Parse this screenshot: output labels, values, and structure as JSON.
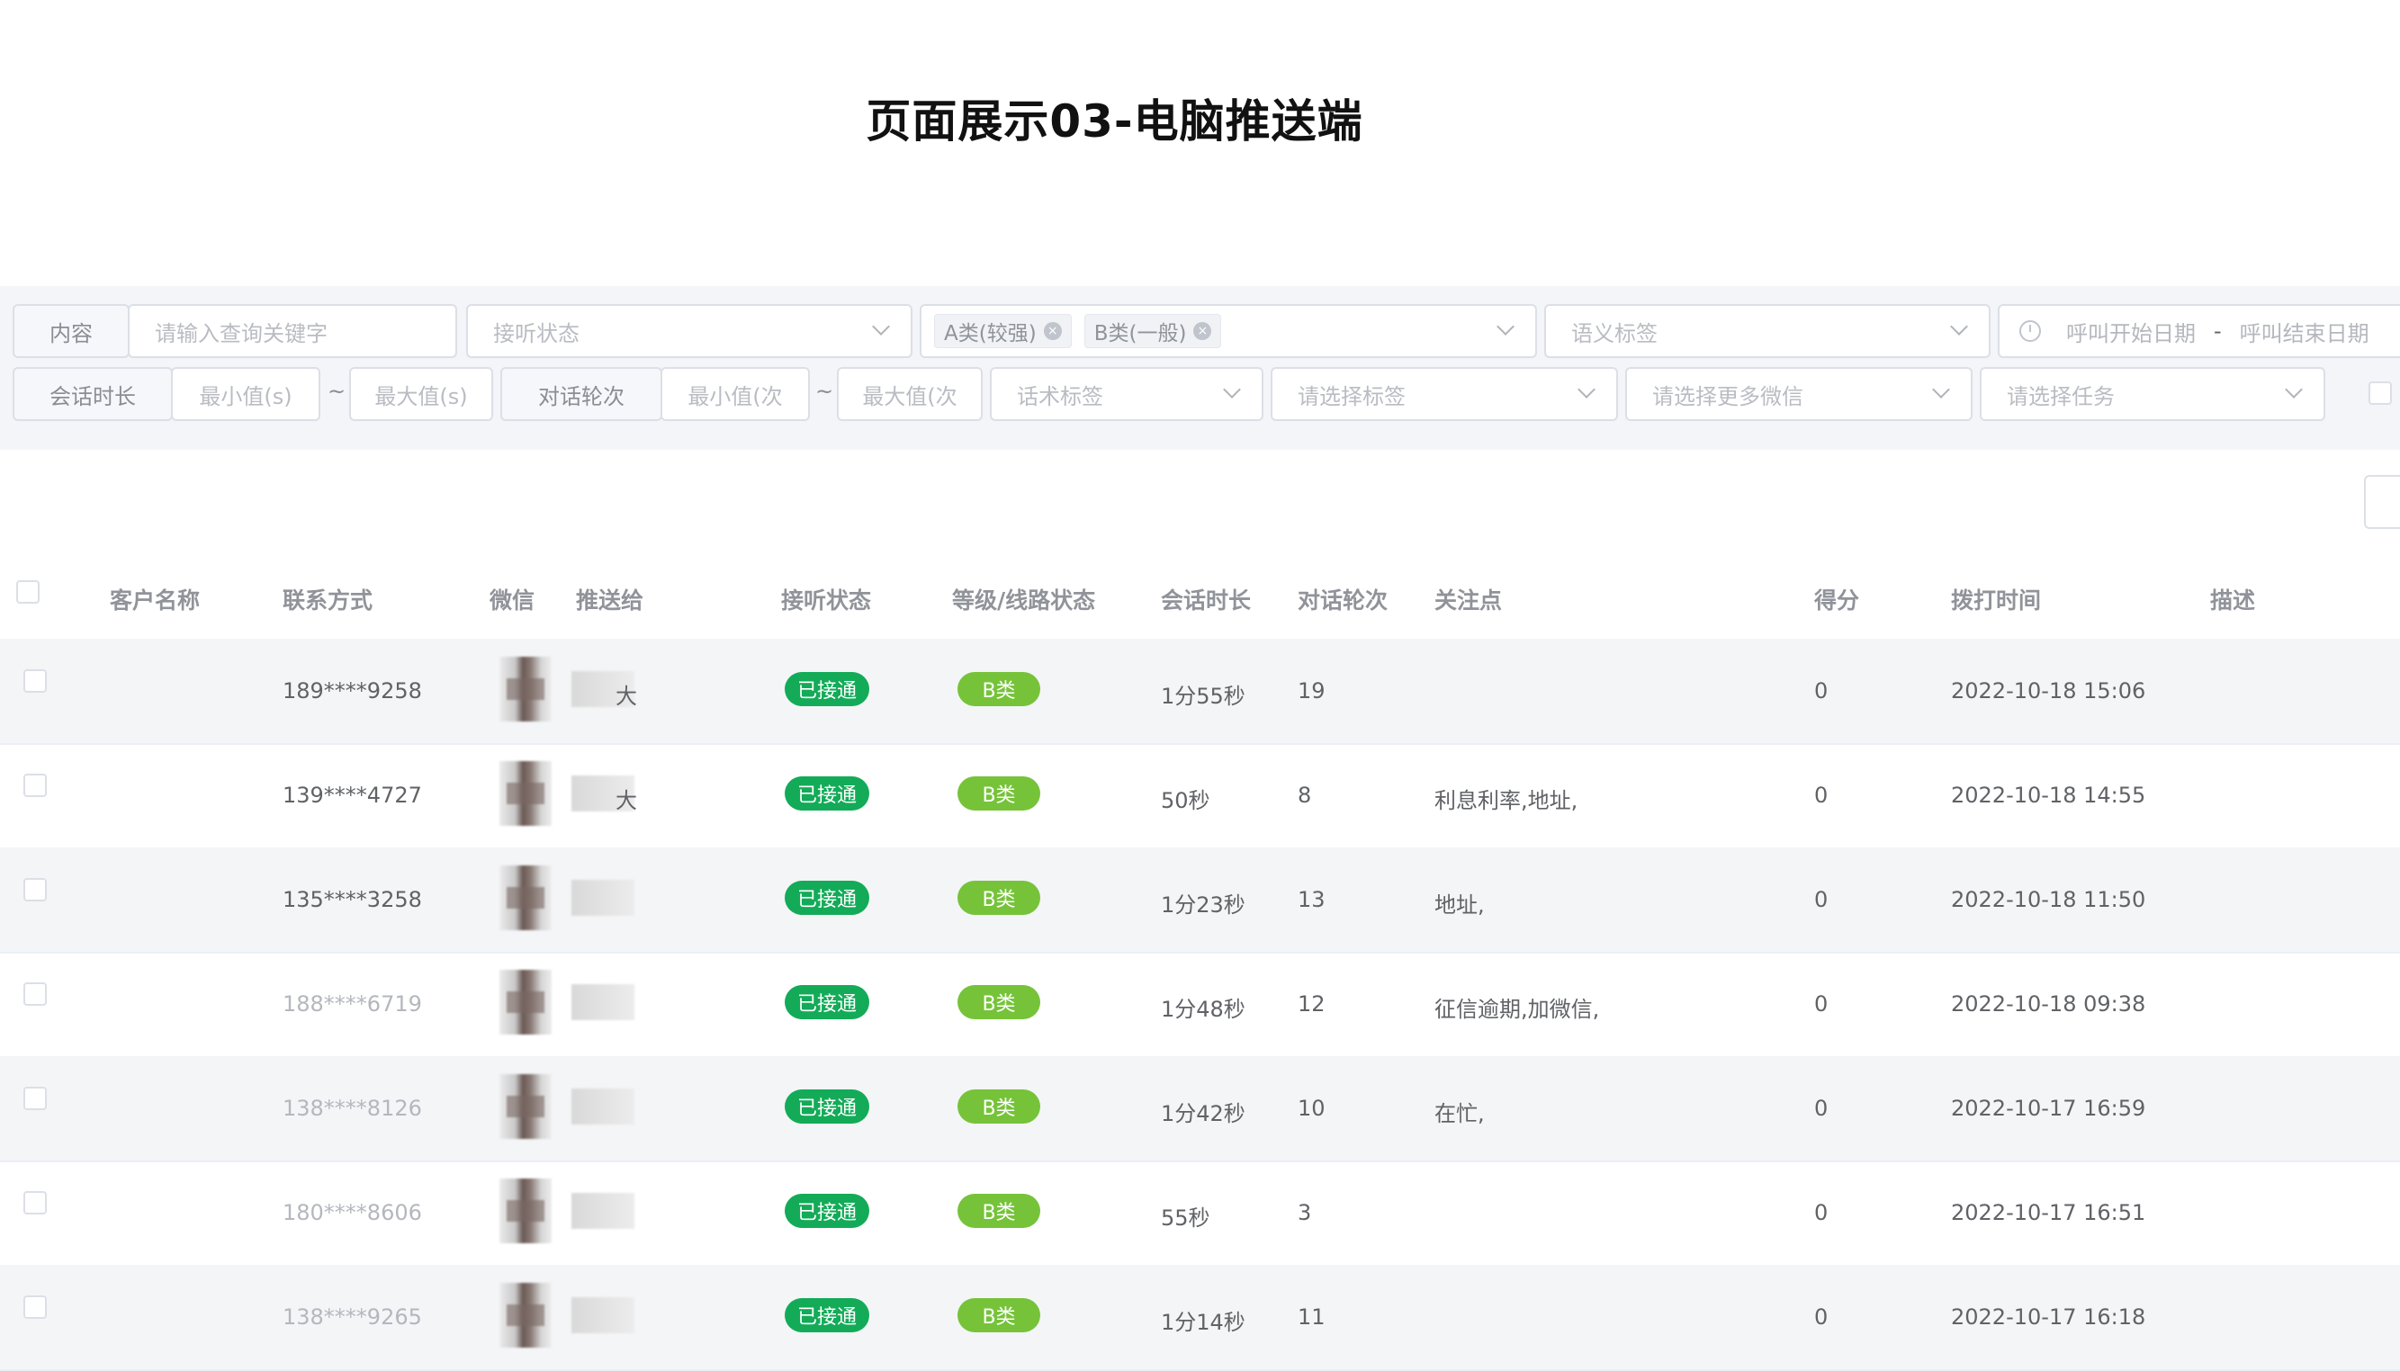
{
  "title": "页面展示03-电脑推送端",
  "filters": {
    "content_label": "内容",
    "keyword_placeholder": "请输入查询关键字",
    "answer_status_placeholder": "接听状态",
    "level_tags": [
      "A类(较强)",
      "B类(一般)"
    ],
    "semantic_tag_placeholder": "语义标签",
    "start_date_placeholder": "呼叫开始日期",
    "date_separator": "-",
    "end_date_placeholder": "呼叫结束日期",
    "duration_label": "会话时长",
    "duration_min_placeholder": "最小值(s)",
    "duration_max_placeholder": "最大值(s)",
    "range_separator": "~",
    "rounds_label": "对话轮次",
    "rounds_min_placeholder": "最小值(次",
    "rounds_max_placeholder": "最大值(次",
    "script_tag_placeholder": "话术标签",
    "select_tag_placeholder": "请选择标签",
    "wechat_placeholder": "请选择更多微信",
    "task_placeholder": "请选择任务"
  },
  "table": {
    "headers": {
      "customer": "客户名称",
      "contact": "联系方式",
      "wechat": "微信",
      "pushed_to": "推送给",
      "answer_status": "接听状态",
      "level": "等级/线路状态",
      "duration": "会话时长",
      "rounds": "对话轮次",
      "focus": "关注点",
      "score": "得分",
      "dial_time": "拨打时间",
      "desc": "描述"
    },
    "rows": [
      {
        "name": "",
        "phone": "189****9258",
        "pushed_to": "大",
        "status": "已接通",
        "level": "B类",
        "duration": "1分55秒",
        "rounds": "19",
        "focus": "",
        "score": "0",
        "time": "2022-10-18 15:06",
        "desc": ""
      },
      {
        "name": "",
        "phone": "139****4727",
        "pushed_to": "大",
        "status": "已接通",
        "level": "B类",
        "duration": "50秒",
        "rounds": "8",
        "focus": "利息利率,地址,",
        "score": "0",
        "time": "2022-10-18 14:55",
        "desc": ""
      },
      {
        "name": "",
        "phone": "135****3258",
        "pushed_to": "",
        "status": "已接通",
        "level": "B类",
        "duration": "1分23秒",
        "rounds": "13",
        "focus": "地址,",
        "score": "0",
        "time": "2022-10-18 11:50",
        "desc": ""
      },
      {
        "name": "",
        "phone": "188****6719",
        "pushed_to": "",
        "status": "已接通",
        "level": "B类",
        "duration": "1分48秒",
        "rounds": "12",
        "focus": "征信逾期,加微信,",
        "score": "0",
        "time": "2022-10-18 09:38",
        "desc": ""
      },
      {
        "name": "",
        "phone": "138****8126",
        "pushed_to": "",
        "status": "已接通",
        "level": "B类",
        "duration": "1分42秒",
        "rounds": "10",
        "focus": "在忙,",
        "score": "0",
        "time": "2022-10-17 16:59",
        "desc": ""
      },
      {
        "name": "",
        "phone": "180****8606",
        "pushed_to": "",
        "status": "已接通",
        "level": "B类",
        "duration": "55秒",
        "rounds": "3",
        "focus": "",
        "score": "0",
        "time": "2022-10-17 16:51",
        "desc": ""
      },
      {
        "name": "",
        "phone": "138****9265",
        "pushed_to": "",
        "status": "已接通",
        "level": "B类",
        "duration": "1分14秒",
        "rounds": "11",
        "focus": "",
        "score": "0",
        "time": "2022-10-17 16:18",
        "desc": ""
      }
    ]
  },
  "colors": {
    "connected_badge": "#13ab58",
    "level_badge": "#76c33a",
    "filter_bg": "#f3f5f8",
    "row_alt_bg": "#f4f5f7"
  },
  "icons": [
    "chevron-down-icon",
    "tag-close-icon",
    "clock-icon"
  ]
}
